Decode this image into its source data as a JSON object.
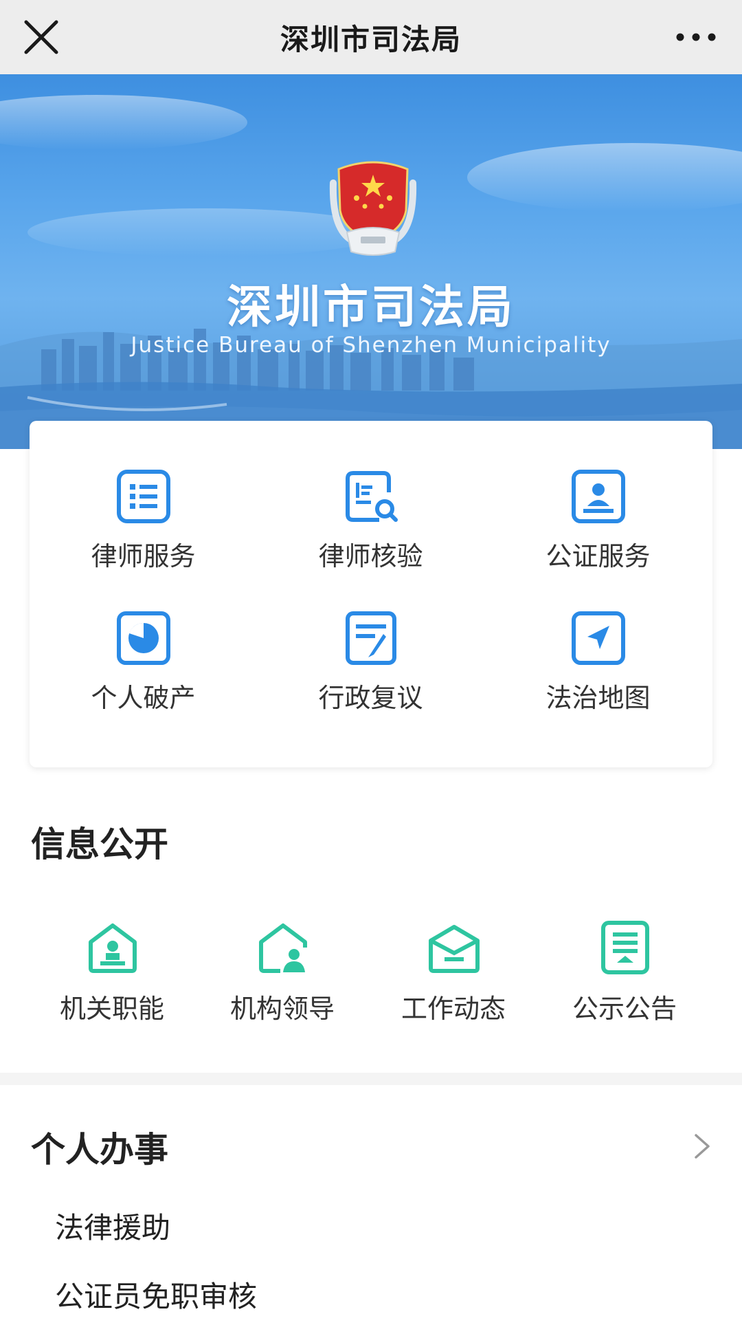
{
  "navbar": {
    "title": "深圳市司法局"
  },
  "banner": {
    "title": "深圳市司法局",
    "subtitle": "Justice Bureau of Shenzhen Municipality"
  },
  "services": [
    {
      "label": "律师服务",
      "icon": "list-document-icon"
    },
    {
      "label": "律师核验",
      "icon": "document-search-icon"
    },
    {
      "label": "公证服务",
      "icon": "id-card-icon"
    },
    {
      "label": "个人破产",
      "icon": "pie-chart-icon"
    },
    {
      "label": "行政复议",
      "icon": "edit-document-icon"
    },
    {
      "label": "法治地图",
      "icon": "location-arrow-icon"
    }
  ],
  "info_public": {
    "title": "信息公开",
    "items": [
      {
        "label": "机关职能",
        "icon": "institution-icon"
      },
      {
        "label": "机构领导",
        "icon": "leader-house-icon"
      },
      {
        "label": "工作动态",
        "icon": "envelope-icon"
      },
      {
        "label": "公示公告",
        "icon": "notice-document-icon"
      }
    ]
  },
  "personal": {
    "title": "个人办事",
    "items": [
      "法律援助",
      "公证员免职审核"
    ]
  },
  "colors": {
    "blue_icon": "#2a8ae6",
    "green_icon": "#2ec5a0",
    "nav_bg": "#ededed"
  }
}
